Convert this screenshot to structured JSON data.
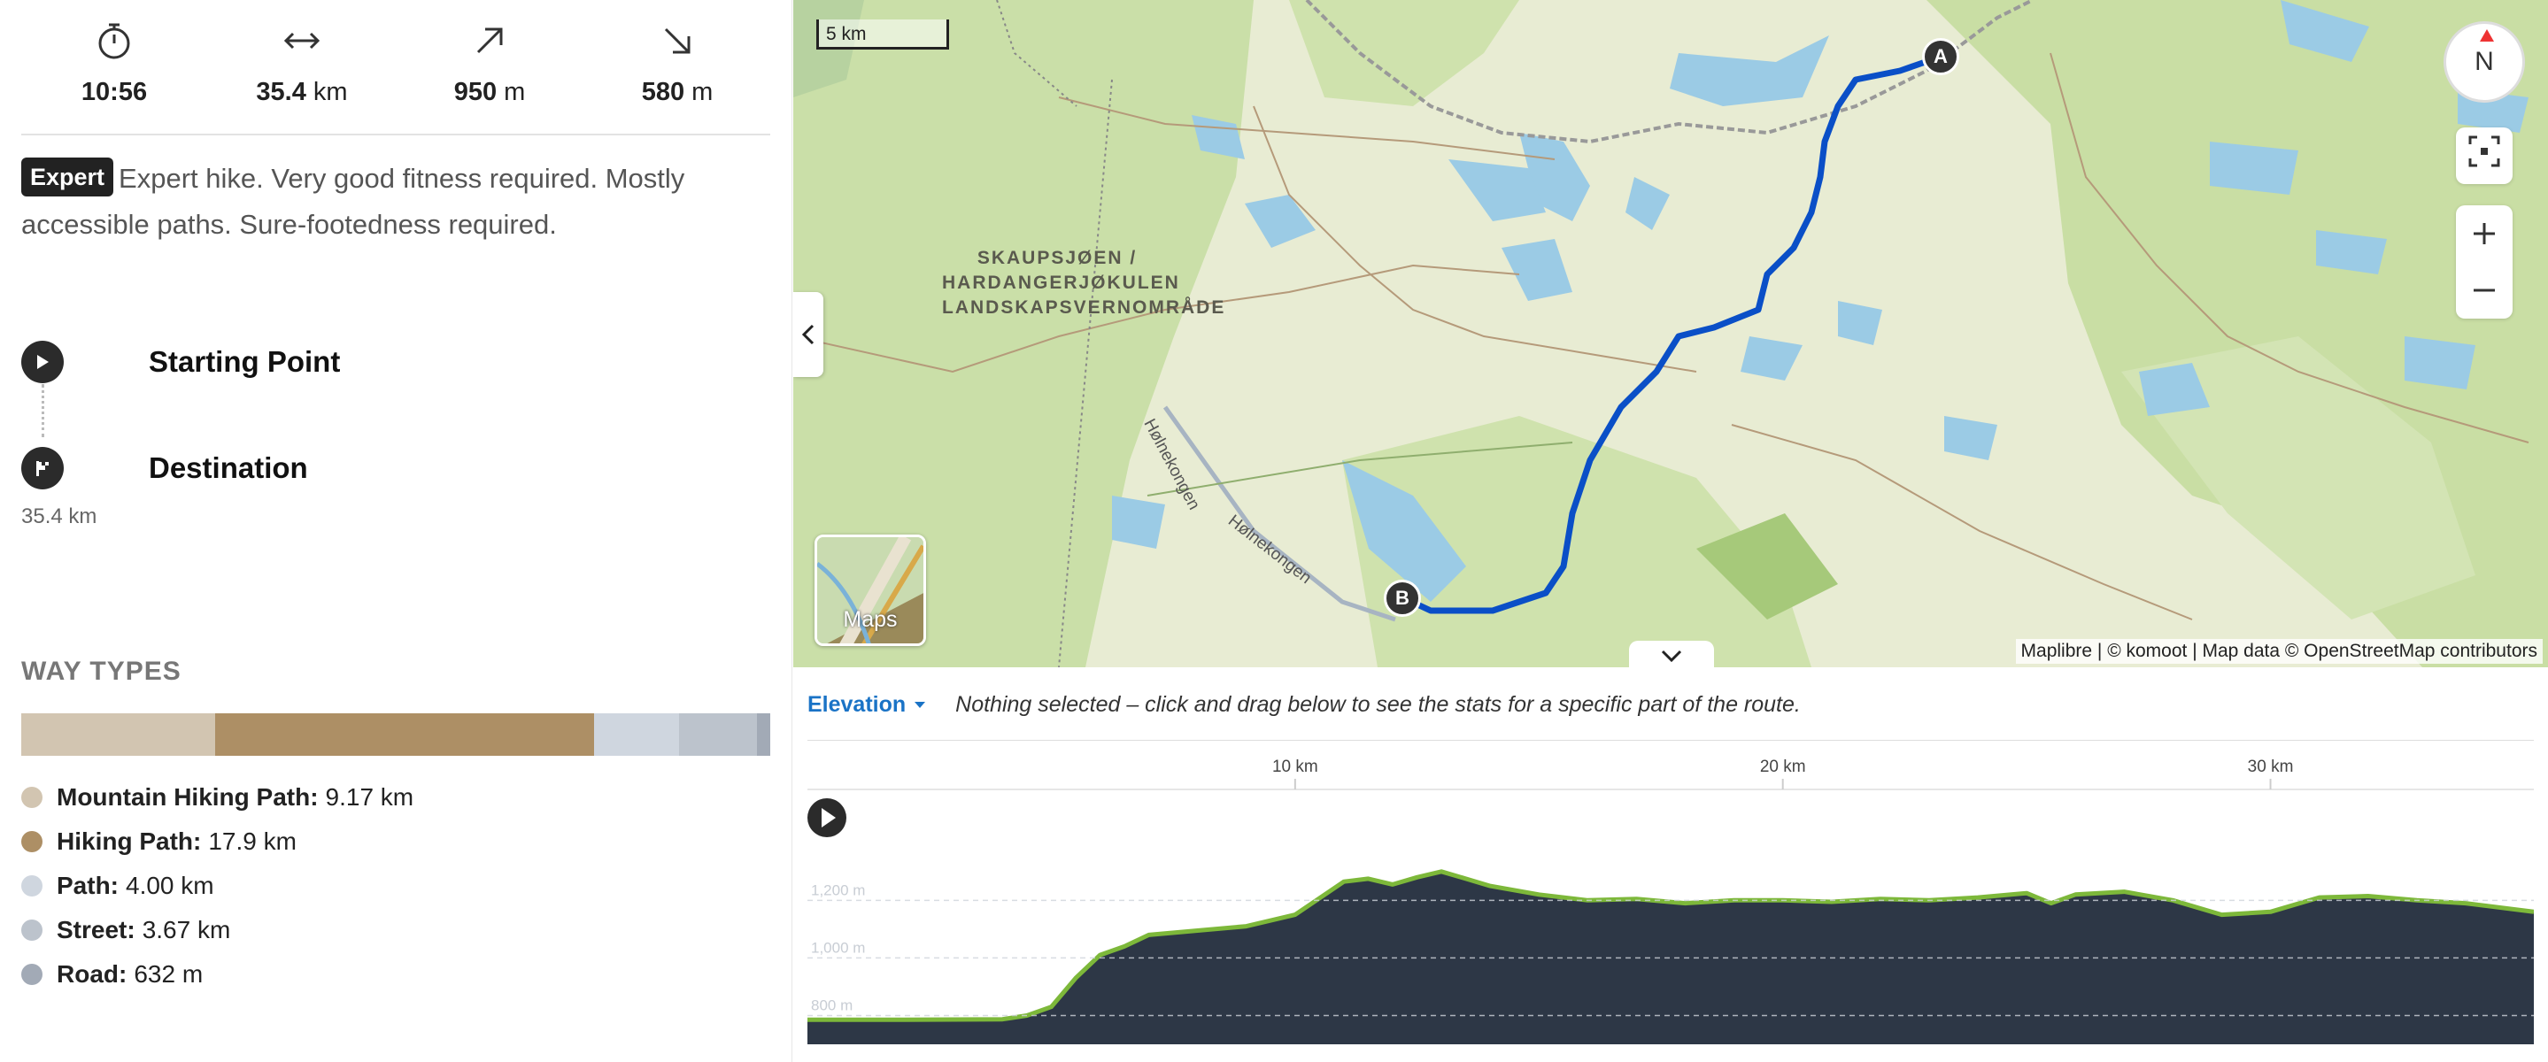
{
  "stats": {
    "duration": {
      "icon": "stopwatch-icon",
      "value": "10:56",
      "unit": ""
    },
    "distance": {
      "icon": "horizontal-arrows-icon",
      "value": "35.4",
      "unit": "km"
    },
    "uphill": {
      "icon": "arrow-up-right-icon",
      "value": "950",
      "unit": "m"
    },
    "downhill": {
      "icon": "arrow-down-right-icon",
      "value": "580",
      "unit": "m"
    }
  },
  "difficulty": {
    "badge": "Expert",
    "text": "Expert hike. Very good fitness required. Mostly accessible paths. Sure-footedness required."
  },
  "waypoints": {
    "start_label": "Starting Point",
    "destination_label": "Destination",
    "distance": "35.4 km"
  },
  "way_types": {
    "title": "WAY TYPES",
    "items": [
      {
        "name": "Mountain Hiking Path:",
        "value": "9.17 km",
        "km": 9.17,
        "color": "#d2c5b1"
      },
      {
        "name": "Hiking Path:",
        "value": "17.9 km",
        "km": 17.9,
        "color": "#ad8f65"
      },
      {
        "name": "Path:",
        "value": "4.00 km",
        "km": 4.0,
        "color": "#cfd6df"
      },
      {
        "name": "Street:",
        "value": "3.67 km",
        "km": 3.67,
        "color": "#bcc3cc"
      },
      {
        "name": "Road:",
        "value": "632 m",
        "km": 0.632,
        "color": "#a2aab6"
      }
    ]
  },
  "map": {
    "scale_label": "5 km",
    "area_label": "SKAUPSJØEN / HARDANGERJØKULEN LANDSKAPSVERNOMRÅDE",
    "road_label_1": "Hølnekongen",
    "road_label_2": "Hølnekongen",
    "start_marker": "A",
    "end_marker": "B",
    "compass_label": "N",
    "layers_label": "Maps",
    "attribution": "Maplibre | © komoot | Map data © OpenStreetMap contributors",
    "route_color": "#0a4fc7"
  },
  "elevation": {
    "dropdown_label": "Elevation",
    "message": "Nothing selected – click and drag below to see the stats for a specific part of the route.",
    "x_ticks": [
      "10 km",
      "20 km",
      "30 km"
    ],
    "y_ticks": [
      "1,200 m",
      "1,000 m",
      "800 m"
    ],
    "fill_color": "#2d3746",
    "line_color": "#7db83a"
  },
  "chart_data": {
    "type": "area",
    "title": "",
    "xlabel": "",
    "ylabel": "",
    "x_unit": "km",
    "y_unit": "m",
    "xlim": [
      0,
      35.4
    ],
    "ylim": [
      700,
      1450
    ],
    "x": [
      0,
      2,
      4,
      4.5,
      5.0,
      5.5,
      6.0,
      6.5,
      7.0,
      8.0,
      9.0,
      10.0,
      11.0,
      11.5,
      12.0,
      12.5,
      13.0,
      13.5,
      14.0,
      15.0,
      16.0,
      17.0,
      18.0,
      19.0,
      20.0,
      21.0,
      22.0,
      23.0,
      24.0,
      25.0,
      25.5,
      26.0,
      27.0,
      28.0,
      29.0,
      30.0,
      31.0,
      32.0,
      33.0,
      34.0,
      35.4
    ],
    "values": [
      785,
      785,
      787,
      800,
      830,
      930,
      1010,
      1040,
      1080,
      1095,
      1110,
      1150,
      1265,
      1275,
      1255,
      1280,
      1300,
      1275,
      1250,
      1220,
      1200,
      1205,
      1190,
      1200,
      1200,
      1195,
      1205,
      1200,
      1210,
      1225,
      1190,
      1220,
      1230,
      1200,
      1150,
      1160,
      1210,
      1215,
      1200,
      1190,
      1160
    ]
  }
}
